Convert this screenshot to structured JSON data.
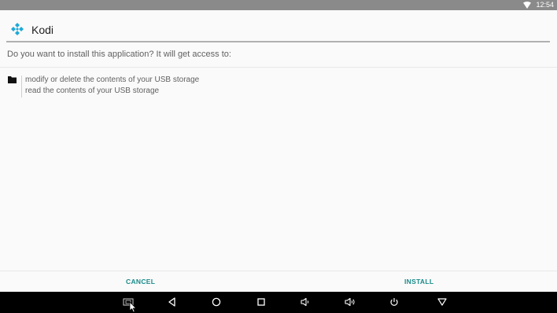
{
  "status_bar": {
    "time": "12:54",
    "wifi_icon": "wifi-icon"
  },
  "header": {
    "app_name": "Kodi",
    "logo_icon": "kodi-logo-icon"
  },
  "prompt": {
    "text": "Do you want to install this application? It will get access to:"
  },
  "permissions": {
    "group_icon": "folder-icon",
    "items": [
      {
        "label": "modify or delete the contents of your USB storage"
      },
      {
        "label": "read the contents of your USB storage"
      }
    ]
  },
  "actions": {
    "cancel_label": "CANCEL",
    "install_label": "INSTALL",
    "accent_color": "#1a8a8a"
  },
  "nav_bar": {
    "icons": [
      "screenshot-icon",
      "back-icon",
      "home-icon",
      "recents-icon",
      "volume-down-icon",
      "volume-up-icon",
      "power-icon",
      "menu-down-icon"
    ]
  }
}
